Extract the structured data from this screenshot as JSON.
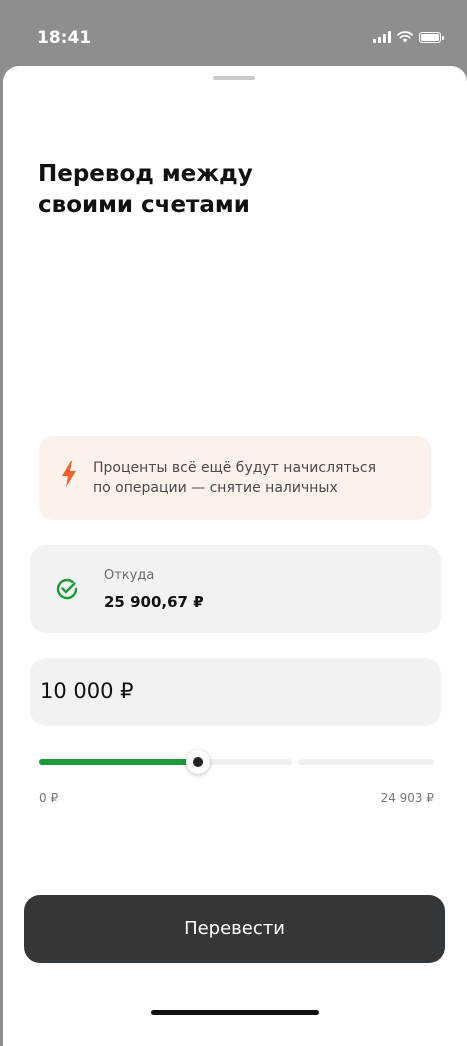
{
  "status_bar": {
    "time": "18:41"
  },
  "sheet": {
    "title_line1": "Перевод между",
    "title_line2": "своими счетами"
  },
  "info_banner": {
    "line1": "Проценты всё ещё будут начисляться",
    "line2": "по операции — снятие наличных",
    "icon": "lightning-icon",
    "accent": "#f2622e",
    "background": "#fdf1ec"
  },
  "source": {
    "label": "Откуда",
    "amount": "25 900,67 ₽",
    "icon": "check-circle-icon",
    "status_color": "#1f9a3a"
  },
  "amount_input": {
    "value": "10 000 ₽"
  },
  "slider": {
    "min_label": "0 ₽",
    "max_label": "24 903 ₽",
    "min": 0,
    "max": 24903,
    "value": 10000,
    "fill_color": "#1f9a3a"
  },
  "submit": {
    "label": "Перевести"
  }
}
